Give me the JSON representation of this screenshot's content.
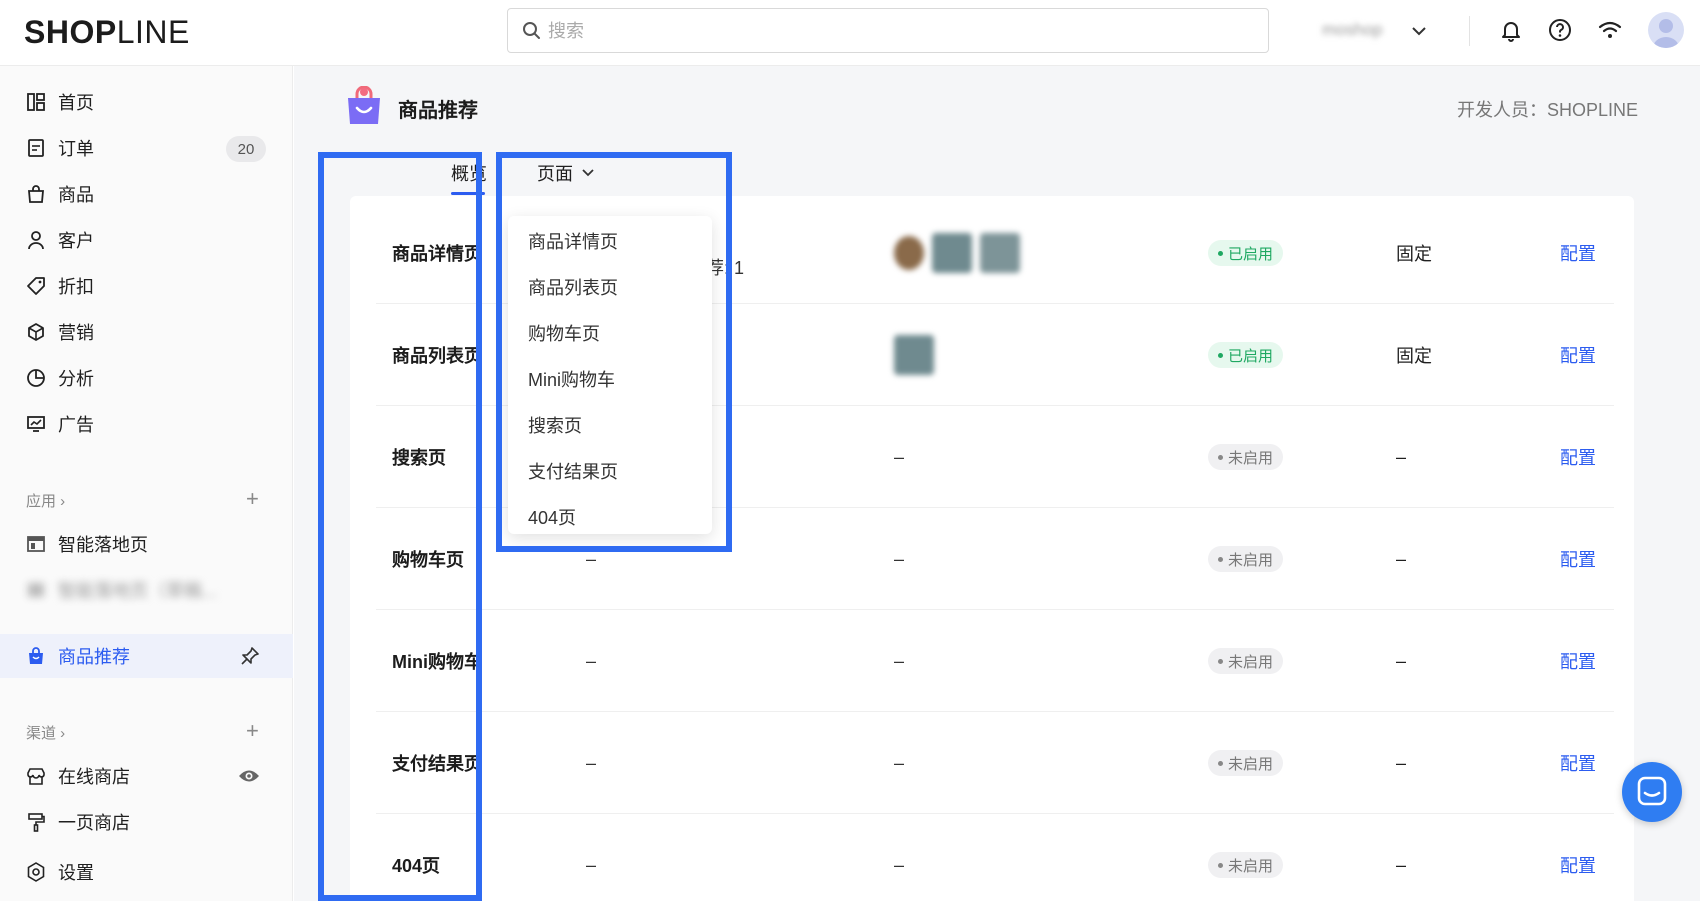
{
  "brand": {
    "logo_bold": "SHOP",
    "logo_thin": "LINE"
  },
  "search": {
    "placeholder": "搜索"
  },
  "header": {
    "shop_name": "moshop"
  },
  "sidebar": {
    "items": [
      {
        "label": "首页"
      },
      {
        "label": "订单",
        "badge": "20"
      },
      {
        "label": "商品"
      },
      {
        "label": "客户"
      },
      {
        "label": "折扣"
      },
      {
        "label": "营销"
      },
      {
        "label": "分析"
      },
      {
        "label": "广告"
      }
    ],
    "apps_title": "应用 ›",
    "apps": [
      {
        "label": "智能落地页"
      },
      {
        "label": "智能落地页（草稿..."
      },
      {
        "label": "商品推荐"
      }
    ],
    "channels_title": "渠道 ›",
    "channels": [
      {
        "label": "在线商店"
      },
      {
        "label": "一页商店"
      }
    ],
    "settings_label": "设置"
  },
  "app": {
    "title": "商品推荐",
    "developer": "开发人员：SHOPLINE"
  },
  "tabs": {
    "overview": "概览",
    "pages": "页面"
  },
  "table": {
    "rows": [
      {
        "name": "商品详情页",
        "a": "",
        "b": "",
        "status": "已启用",
        "mode": "固定",
        "action": "配置"
      },
      {
        "name": "商品列表页",
        "a": "",
        "b": "",
        "status": "已启用",
        "mode": "固定",
        "action": "配置"
      },
      {
        "name": "搜索页",
        "a": "",
        "b": "–",
        "status": "未启用",
        "mode": "–",
        "action": "配置"
      },
      {
        "name": "购物车页",
        "a": "–",
        "b": "–",
        "status": "未启用",
        "mode": "–",
        "action": "配置"
      },
      {
        "name": "Mini购物车",
        "a": "–",
        "b": "–",
        "status": "未启用",
        "mode": "–",
        "action": "配置"
      },
      {
        "name": "支付结果页",
        "a": "–",
        "b": "–",
        "status": "未启用",
        "mode": "–",
        "action": "配置"
      },
      {
        "name": "404页",
        "a": "–",
        "b": "–",
        "status": "未启用",
        "mode": "–",
        "action": "配置"
      }
    ],
    "partial_text": "荐: 1"
  },
  "dropdown": {
    "items": [
      "商品详情页",
      "商品列表页",
      "购物车页",
      "Mini购物车",
      "搜索页",
      "支付结果页",
      "404页"
    ]
  },
  "colors": {
    "accent": "#2c5cf0",
    "highlight": "#2f6bf2",
    "enabled": "#1fa862"
  }
}
